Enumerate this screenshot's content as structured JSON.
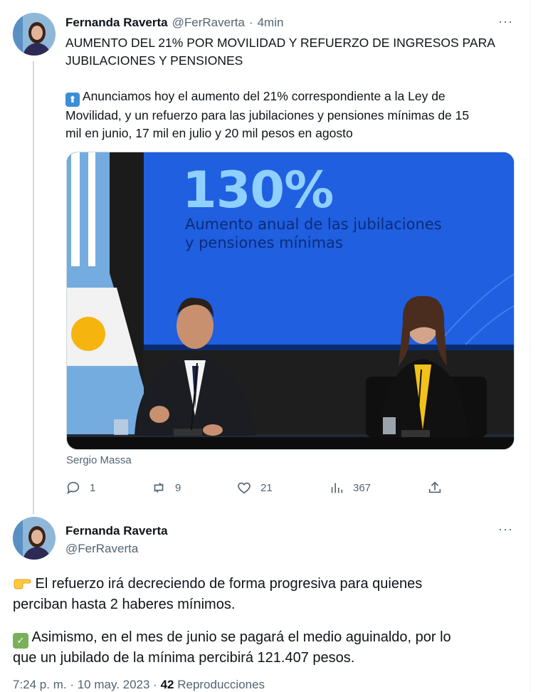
{
  "tweet1": {
    "author_name": "Fernanda Raverta",
    "author_handle": "@FerRaverta",
    "separator": "·",
    "time_ago": "4min",
    "more_label": "···",
    "text_line1": "AUMENTO DEL 21% POR MOVILIDAD Y REFUERZO DE INGRESOS PARA",
    "text_line2": "JUBILACIONES Y PENSIONES",
    "body_line1": " Anunciamos hoy el aumento del 21% correspondiente a la Ley de",
    "body_line2": "Movilidad, y un refuerzo para las jubilaciones y pensiones mínimas de 15",
    "body_line3": "mil en junio, 17 mil en julio y 20 mil pesos en agosto",
    "up_icon_glyph": "⬆",
    "media": {
      "screen_big": "130%",
      "screen_line1": "Aumento anual de las jubilaciones",
      "screen_line2": "y pensiones mínimas"
    },
    "caption": "Sergio Massa",
    "actions": {
      "replies": "1",
      "retweets": "9",
      "likes": "21",
      "views": "367"
    }
  },
  "tweet2": {
    "author_name": "Fernanda Raverta",
    "author_handle": "@FerRaverta",
    "more_label": "···",
    "p1_line1": " El refuerzo irá decreciendo de forma progresiva para quienes",
    "p1_line2": "perciban hasta 2 haberes mínimos.",
    "p2_line1": " Asimismo, en el mes de junio se pagará el medio aguinaldo, por lo",
    "p2_line2": "que un jubilado de la mínima percibirá 121.407 pesos.",
    "check_glyph": "✓",
    "footer_time": "7:24 p. m. · 10 may. 2023 · ",
    "footer_views_count": "42",
    "footer_views_label": " Reproducciones"
  },
  "colors": {
    "text_primary": "#0f1419",
    "text_secondary": "#536471",
    "screen_blue": "#1f5fe0",
    "flag_blue": "#74acdf"
  }
}
